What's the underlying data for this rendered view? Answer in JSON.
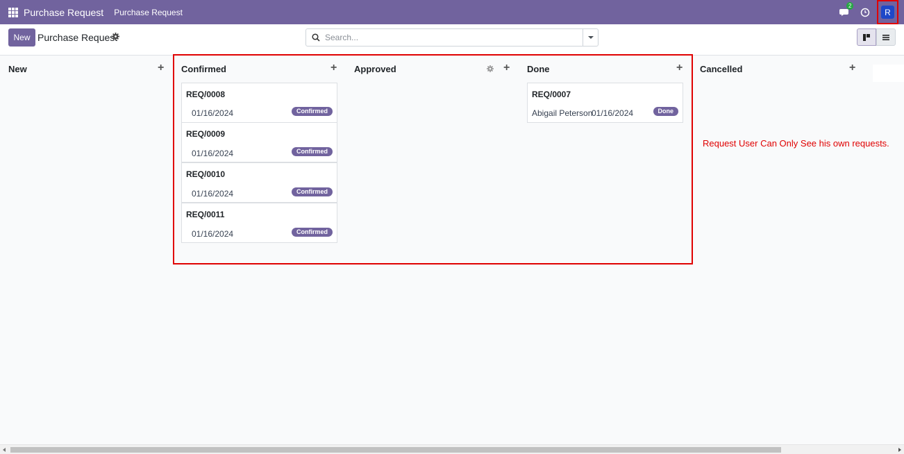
{
  "navbar": {
    "brand": "Purchase Request",
    "menu": "Purchase Request",
    "chat_count": "2",
    "avatar_initial": "R",
    "bg_color": "#71639e",
    "avatar_color": "#1e47c8"
  },
  "control": {
    "new_label": "New",
    "title": "Purchase Request",
    "search_placeholder": "Search..."
  },
  "columns": [
    {
      "title": "New"
    },
    {
      "title": "Confirmed"
    },
    {
      "title": "Approved"
    },
    {
      "title": "Done"
    },
    {
      "title": "Cancelled"
    }
  ],
  "cards": {
    "confirmed": [
      {
        "ref": "REQ/0008",
        "date": "01/16/2024",
        "state": "Confirmed"
      },
      {
        "ref": "REQ/0009",
        "date": "01/16/2024",
        "state": "Confirmed"
      },
      {
        "ref": "REQ/0010",
        "date": "01/16/2024",
        "state": "Confirmed"
      },
      {
        "ref": "REQ/0011",
        "date": "01/16/2024",
        "state": "Confirmed"
      }
    ],
    "done": [
      {
        "ref": "REQ/0007",
        "person": "Abigail Peterson",
        "date": "01/16/2024",
        "state": "Done"
      }
    ]
  },
  "note": "Request User Can Only See his own requests."
}
